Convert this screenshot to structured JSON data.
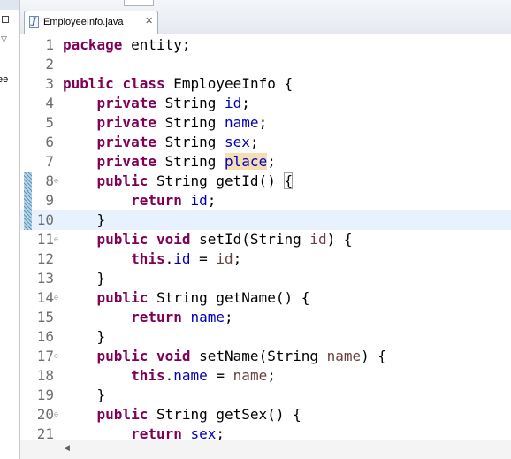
{
  "left_panel": {
    "label_fragment": "ee"
  },
  "tab": {
    "filename": "EmployeeInfo.java",
    "file_icon_letter": "J",
    "close_glyph": "✕"
  },
  "editor": {
    "current_line": 10,
    "lines": [
      {
        "num": "1",
        "fold": "",
        "marker": false,
        "tokens": [
          {
            "t": "package",
            "c": "kw"
          },
          {
            "t": " entity;"
          }
        ]
      },
      {
        "num": "2",
        "fold": "",
        "marker": false,
        "tokens": []
      },
      {
        "num": "3",
        "fold": "",
        "marker": false,
        "tokens": [
          {
            "t": "public",
            "c": "kw"
          },
          {
            "t": " "
          },
          {
            "t": "class",
            "c": "kw"
          },
          {
            "t": " EmployeeInfo {"
          }
        ]
      },
      {
        "num": "4",
        "fold": "",
        "marker": false,
        "tokens": [
          {
            "t": "    "
          },
          {
            "t": "private",
            "c": "kw"
          },
          {
            "t": " String "
          },
          {
            "t": "id",
            "c": "fld"
          },
          {
            "t": ";"
          }
        ]
      },
      {
        "num": "5",
        "fold": "",
        "marker": false,
        "tokens": [
          {
            "t": "    "
          },
          {
            "t": "private",
            "c": "kw"
          },
          {
            "t": " String "
          },
          {
            "t": "name",
            "c": "fld"
          },
          {
            "t": ";"
          }
        ]
      },
      {
        "num": "6",
        "fold": "",
        "marker": false,
        "tokens": [
          {
            "t": "    "
          },
          {
            "t": "private",
            "c": "kw"
          },
          {
            "t": " String "
          },
          {
            "t": "sex",
            "c": "fld"
          },
          {
            "t": ";"
          }
        ]
      },
      {
        "num": "7",
        "fold": "",
        "marker": false,
        "tokens": [
          {
            "t": "    "
          },
          {
            "t": "private",
            "c": "kw"
          },
          {
            "t": " String "
          },
          {
            "t": "place",
            "c": "fld hl"
          },
          {
            "t": ";"
          }
        ]
      },
      {
        "num": "8",
        "fold": "⊖",
        "marker": true,
        "tokens": [
          {
            "t": "    "
          },
          {
            "t": "public",
            "c": "kw"
          },
          {
            "t": " String getId() "
          },
          {
            "t": "{",
            "c": "bracebox"
          }
        ]
      },
      {
        "num": "9",
        "fold": "",
        "marker": true,
        "tokens": [
          {
            "t": "        "
          },
          {
            "t": "return",
            "c": "kw"
          },
          {
            "t": " "
          },
          {
            "t": "id",
            "c": "fld"
          },
          {
            "t": ";"
          }
        ]
      },
      {
        "num": "10",
        "fold": "",
        "marker": true,
        "tokens": [
          {
            "t": "    }"
          }
        ]
      },
      {
        "num": "11",
        "fold": "⊖",
        "marker": false,
        "tokens": [
          {
            "t": "    "
          },
          {
            "t": "public",
            "c": "kw"
          },
          {
            "t": " "
          },
          {
            "t": "void",
            "c": "kw"
          },
          {
            "t": " setId(String "
          },
          {
            "t": "id",
            "c": "prm"
          },
          {
            "t": ") {"
          }
        ]
      },
      {
        "num": "12",
        "fold": "",
        "marker": false,
        "tokens": [
          {
            "t": "        "
          },
          {
            "t": "this",
            "c": "kw"
          },
          {
            "t": "."
          },
          {
            "t": "id",
            "c": "fld"
          },
          {
            "t": " = "
          },
          {
            "t": "id",
            "c": "prm"
          },
          {
            "t": ";"
          }
        ]
      },
      {
        "num": "13",
        "fold": "",
        "marker": false,
        "tokens": [
          {
            "t": "    }"
          }
        ]
      },
      {
        "num": "14",
        "fold": "⊖",
        "marker": false,
        "tokens": [
          {
            "t": "    "
          },
          {
            "t": "public",
            "c": "kw"
          },
          {
            "t": " String getName() {"
          }
        ]
      },
      {
        "num": "15",
        "fold": "",
        "marker": false,
        "tokens": [
          {
            "t": "        "
          },
          {
            "t": "return",
            "c": "kw"
          },
          {
            "t": " "
          },
          {
            "t": "name",
            "c": "fld"
          },
          {
            "t": ";"
          }
        ]
      },
      {
        "num": "16",
        "fold": "",
        "marker": false,
        "tokens": [
          {
            "t": "    }"
          }
        ]
      },
      {
        "num": "17",
        "fold": "⊖",
        "marker": false,
        "tokens": [
          {
            "t": "    "
          },
          {
            "t": "public",
            "c": "kw"
          },
          {
            "t": " "
          },
          {
            "t": "void",
            "c": "kw"
          },
          {
            "t": " setName(String "
          },
          {
            "t": "name",
            "c": "prm"
          },
          {
            "t": ") {"
          }
        ]
      },
      {
        "num": "18",
        "fold": "",
        "marker": false,
        "tokens": [
          {
            "t": "        "
          },
          {
            "t": "this",
            "c": "kw"
          },
          {
            "t": "."
          },
          {
            "t": "name",
            "c": "fld"
          },
          {
            "t": " = "
          },
          {
            "t": "name",
            "c": "prm"
          },
          {
            "t": ";"
          }
        ]
      },
      {
        "num": "19",
        "fold": "",
        "marker": false,
        "tokens": [
          {
            "t": "    }"
          }
        ]
      },
      {
        "num": "20",
        "fold": "⊖",
        "marker": false,
        "tokens": [
          {
            "t": "    "
          },
          {
            "t": "public",
            "c": "kw"
          },
          {
            "t": " String getSex() {"
          }
        ]
      },
      {
        "num": "21",
        "fold": "",
        "marker": false,
        "tokens": [
          {
            "t": "        "
          },
          {
            "t": "return",
            "c": "kw"
          },
          {
            "t": " "
          },
          {
            "t": "sex",
            "c": "fld"
          },
          {
            "t": ";"
          }
        ]
      }
    ]
  },
  "scrollbar": {
    "left_arrow": "◀"
  },
  "colors": {
    "keyword": "#7f0055",
    "field": "#0000c0",
    "parameter": "#6a3e3e",
    "current_line_bg": "#e8f2fe",
    "occurrence_highlight": "#f5deb3"
  }
}
